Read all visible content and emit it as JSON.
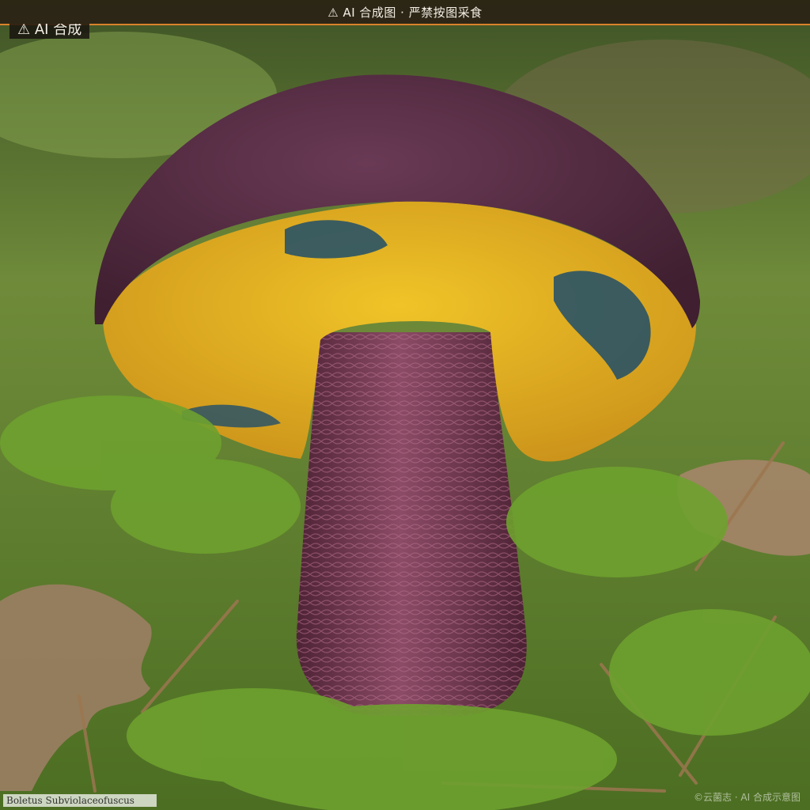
{
  "banner": {
    "text": "⚠ AI 合成图 · 严禁按图采食"
  },
  "tag": {
    "text": "⚠ AI 合成"
  },
  "caption": {
    "text": "Boletus Subviolaceofuscus"
  },
  "watermark": {
    "text": "©云菌志 · AI 合成示意图"
  },
  "colors": {
    "cap": "#5b2f46",
    "pores": "#e5b51e",
    "bruise": "#1f4e6a",
    "stem": "#7c3b55",
    "moss": "#5f8f2a",
    "accent": "#d9822b"
  }
}
